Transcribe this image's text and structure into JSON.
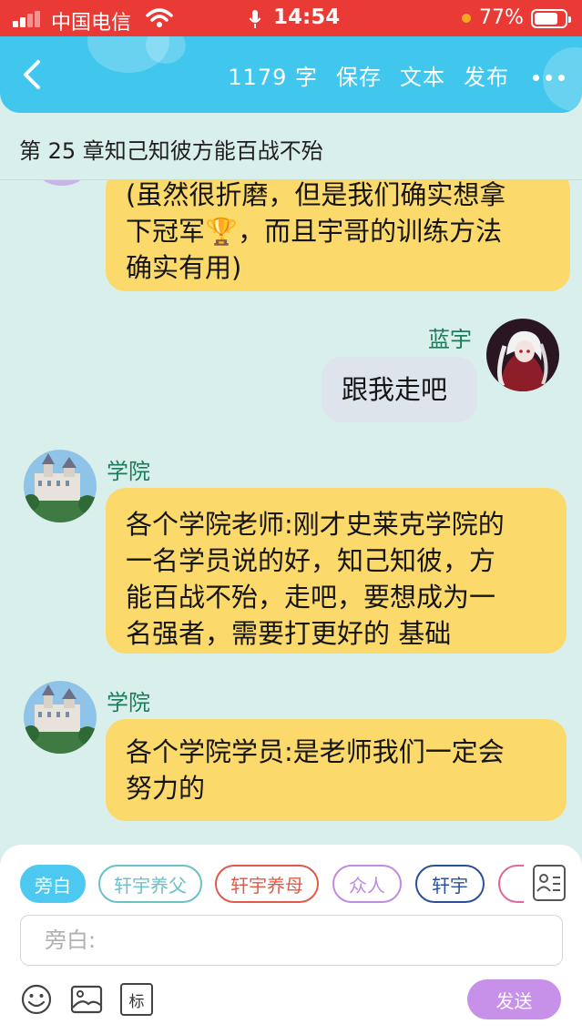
{
  "status_bar": {
    "carrier": "中国电信",
    "time": "14:54",
    "battery": "77%",
    "battery_level": 0.77
  },
  "nav": {
    "word_count": "1179 字",
    "save": "保存",
    "text": "文本",
    "publish": "发布"
  },
  "chapter": {
    "title": "第 25 章知己知彼方能百战不殆"
  },
  "messages": [
    {
      "side": "left",
      "name": "",
      "lines": [
        "(虽然很折磨，但是我们确实想拿",
        "下冠军🏆，而且宇哥的训练方法",
        "确实有用)"
      ]
    },
    {
      "side": "right",
      "name": "蓝宇",
      "lines": [
        "跟我走吧"
      ]
    },
    {
      "side": "left",
      "name": "学院",
      "lines": [
        "各个学院老师:刚才史莱克学院的",
        "一名学员说的好，知己知彼，方",
        "能百战不殆，走吧，要想成为一",
        "名强者，需要打更好的 基础"
      ]
    },
    {
      "side": "left",
      "name": "学院",
      "lines": [
        "各个学院学员:是老师我们一定会",
        "努力的"
      ]
    }
  ],
  "input_panel": {
    "chips": [
      {
        "label": "旁白",
        "color": "#4dc8f0",
        "active": true
      },
      {
        "label": "轩宇养父",
        "color": "#6cc0c8",
        "active": false
      },
      {
        "label": "轩宇养母",
        "color": "#e05a4a",
        "active": false
      },
      {
        "label": "众人",
        "color": "#c18be0",
        "active": false
      },
      {
        "label": "轩宇",
        "color": "#2a4f9a",
        "active": false
      },
      {
        "label": "",
        "color": "#e0669a",
        "active": false
      }
    ],
    "placeholder": "旁白:",
    "tools": [
      "emoji-icon",
      "image-icon",
      "mark-icon"
    ],
    "mark_label": "标",
    "send_label": "发送"
  }
}
